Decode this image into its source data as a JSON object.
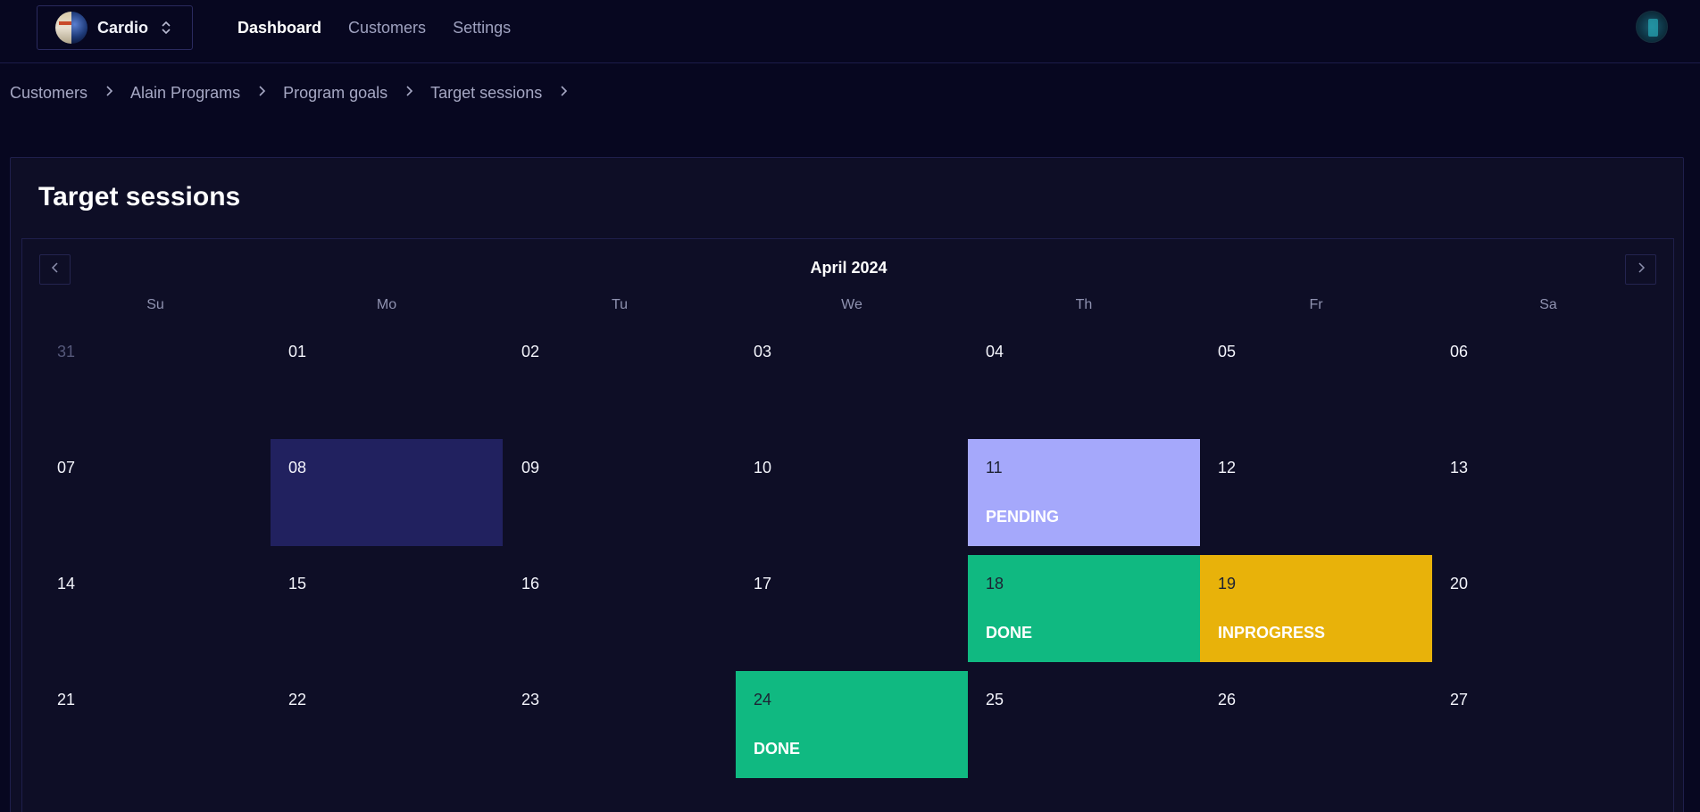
{
  "header": {
    "team_name": "Cardio",
    "nav": [
      {
        "label": "Dashboard",
        "active": true
      },
      {
        "label": "Customers",
        "active": false
      },
      {
        "label": "Settings",
        "active": false
      }
    ]
  },
  "breadcrumb": [
    "Customers",
    "Alain Programs",
    "Program goals",
    "Target sessions"
  ],
  "page": {
    "title": "Target sessions"
  },
  "calendar": {
    "month_label": "April 2024",
    "weekdays": [
      "Su",
      "Mo",
      "Tu",
      "We",
      "Th",
      "Fr",
      "Sa"
    ],
    "weeks": [
      [
        {
          "day": "31",
          "status": "",
          "state": "muted"
        },
        {
          "day": "01",
          "status": "",
          "state": ""
        },
        {
          "day": "02",
          "status": "",
          "state": ""
        },
        {
          "day": "03",
          "status": "",
          "state": ""
        },
        {
          "day": "04",
          "status": "",
          "state": ""
        },
        {
          "day": "05",
          "status": "",
          "state": ""
        },
        {
          "day": "06",
          "status": "",
          "state": ""
        }
      ],
      [
        {
          "day": "07",
          "status": "",
          "state": ""
        },
        {
          "day": "08",
          "status": "",
          "state": "selected"
        },
        {
          "day": "09",
          "status": "",
          "state": ""
        },
        {
          "day": "10",
          "status": "",
          "state": ""
        },
        {
          "day": "11",
          "status": "PENDING",
          "state": "pending"
        },
        {
          "day": "12",
          "status": "",
          "state": ""
        },
        {
          "day": "13",
          "status": "",
          "state": ""
        }
      ],
      [
        {
          "day": "14",
          "status": "",
          "state": ""
        },
        {
          "day": "15",
          "status": "",
          "state": ""
        },
        {
          "day": "16",
          "status": "",
          "state": ""
        },
        {
          "day": "17",
          "status": "",
          "state": ""
        },
        {
          "day": "18",
          "status": "DONE",
          "state": "done"
        },
        {
          "day": "19",
          "status": "INPROGRESS",
          "state": "inprogress"
        },
        {
          "day": "20",
          "status": "",
          "state": ""
        }
      ],
      [
        {
          "day": "21",
          "status": "",
          "state": ""
        },
        {
          "day": "22",
          "status": "",
          "state": ""
        },
        {
          "day": "23",
          "status": "",
          "state": ""
        },
        {
          "day": "24",
          "status": "DONE",
          "state": "done"
        },
        {
          "day": "25",
          "status": "",
          "state": ""
        },
        {
          "day": "26",
          "status": "",
          "state": ""
        },
        {
          "day": "27",
          "status": "",
          "state": ""
        }
      ]
    ]
  },
  "icons": {
    "prev": "chevron-left-icon",
    "next": "chevron-right-icon",
    "separator": "chevron-right-icon",
    "switcher": "chevron-up-down-icon"
  },
  "colors": {
    "background": "#070720",
    "panel": "#0e0e26",
    "selected": "#21215f",
    "pending": "#a5a8fb",
    "done": "#10b981",
    "inprogress": "#e8b20a"
  }
}
